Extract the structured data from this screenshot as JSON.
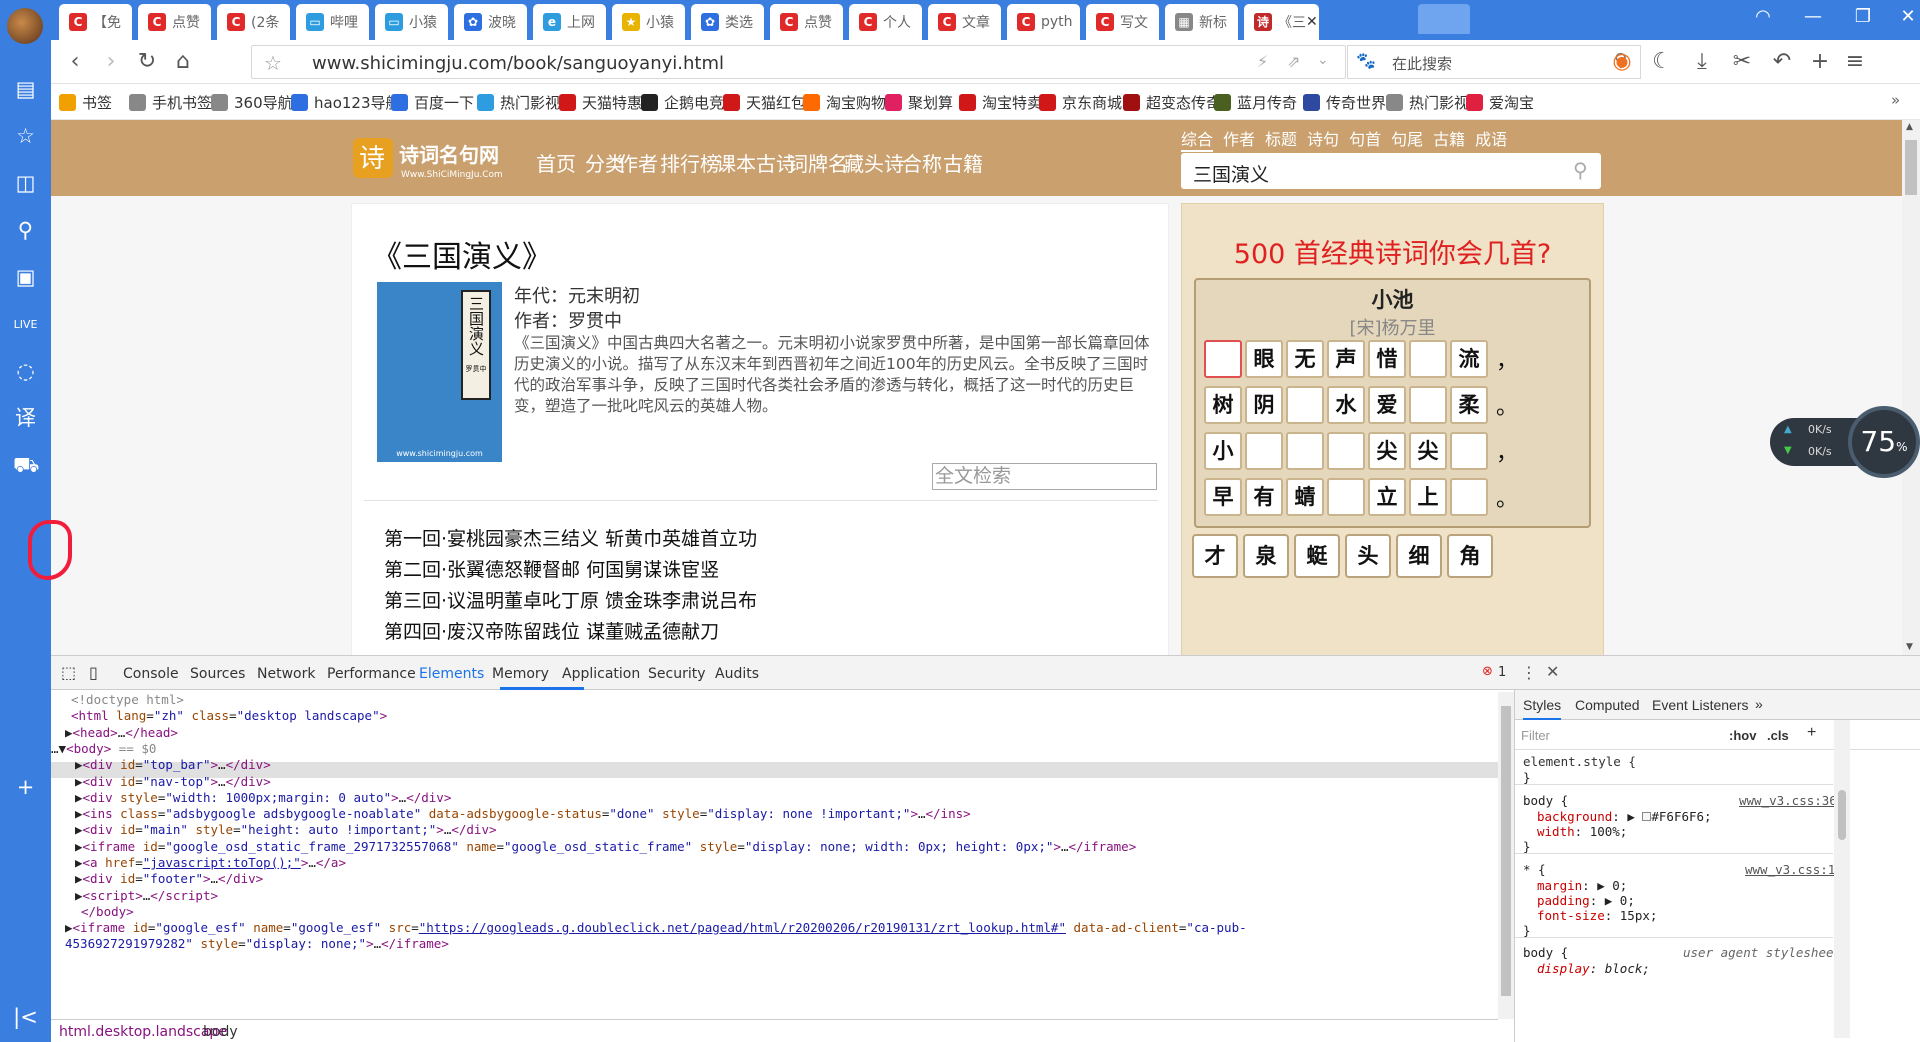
{
  "tabs": [
    {
      "label": "【免",
      "icon": "C",
      "color": "#e02a2a"
    },
    {
      "label": "点赞",
      "icon": "C",
      "color": "#e02a2a"
    },
    {
      "label": "(2条",
      "icon": "C",
      "color": "#e02a2a"
    },
    {
      "label": "哔哩",
      "icon": "tv",
      "color": "#2d9de0"
    },
    {
      "label": "小猿",
      "icon": "tv",
      "color": "#2d9de0"
    },
    {
      "label": "波晓",
      "icon": "paw",
      "color": "#2d6fe0"
    },
    {
      "label": "上网",
      "icon": "e",
      "color": "#2d9de0"
    },
    {
      "label": "小猿",
      "icon": "★",
      "color": "#e8b400"
    },
    {
      "label": "类选",
      "icon": "paw",
      "color": "#2d6fe0"
    },
    {
      "label": "点赞",
      "icon": "C",
      "color": "#e02a2a"
    },
    {
      "label": "个人",
      "icon": "C",
      "color": "#e02a2a"
    },
    {
      "label": "文章",
      "icon": "C",
      "color": "#e02a2a"
    },
    {
      "label": "pyth",
      "icon": "C",
      "color": "#e02a2a"
    },
    {
      "label": "写文",
      "icon": "C",
      "color": "#e02a2a"
    },
    {
      "label": "新标",
      "icon": "grid",
      "color": "#888"
    },
    {
      "label": "《三",
      "icon": "诗",
      "color": "#c02a2a"
    }
  ],
  "url": "www.shicimingju.com/book/sanguoyanyi.html",
  "search_placeholder": "在此搜索",
  "bookmarks": [
    {
      "label": "书签",
      "color": "#f0a000"
    },
    {
      "label": "手机书签",
      "color": "#888"
    },
    {
      "label": "360导航",
      "color": "#888"
    },
    {
      "label": "hao123导航",
      "color": "#2d6fe0"
    },
    {
      "label": "百度一下",
      "color": "#2d6fe0"
    },
    {
      "label": "热门影视",
      "color": "#2d9de0"
    },
    {
      "label": "天猫特惠",
      "color": "#d01818"
    },
    {
      "label": "企鹅电竞",
      "color": "#222"
    },
    {
      "label": "天猫红包",
      "color": "#d01818"
    },
    {
      "label": "淘宝购物",
      "color": "#ff6a00"
    },
    {
      "label": "聚划算",
      "color": "#e02060"
    },
    {
      "label": "淘宝特卖",
      "color": "#d01818"
    },
    {
      "label": "京东商城",
      "color": "#d01818"
    },
    {
      "label": "超变态传奇",
      "color": "#a01010"
    },
    {
      "label": "蓝月传奇",
      "color": "#4a6020"
    },
    {
      "label": "传奇世界",
      "color": "#2d4aa0"
    },
    {
      "label": "热门影视",
      "color": "#888"
    },
    {
      "label": "爱淘宝",
      "color": "#e02040"
    }
  ],
  "site": {
    "nav": [
      "首页",
      "分类",
      "作者",
      "排行榜",
      "课本古诗",
      "词牌名",
      "藏头诗",
      "合称",
      "古籍"
    ],
    "search_tabs": [
      "综合",
      "作者",
      "标题",
      "诗句",
      "句首",
      "句尾",
      "古籍",
      "成语"
    ],
    "search_value": "三国演义"
  },
  "book": {
    "title": "《三国演义》",
    "cover_label": "三国演义",
    "cover_author": "罗贯中",
    "cover_site": "www.shicimingju.com",
    "era": "年代：元末明初",
    "author": "作者：罗贯中",
    "desc": "《三国演义》中国古典四大名著之一。元末明初小说家罗贯中所著，是中国第一部长篇章回体历史演义的小说。描写了从东汉末年到西晋初年之间近100年的历史风云。全书反映了三国时代的政治军事斗争，反映了三国时代各类社会矛盾的渗透与转化，概括了这一时代的历史巨变，塑造了一批叱咤风云的英雄人物。",
    "fulltext_placeholder": "全文检索",
    "chapters": [
      "第一回·宴桃园豪杰三结义 斩黄巾英雄首立功",
      "第二回·张翼德怒鞭督邮 何国舅谋诛宦竖",
      "第三回·议温明董卓叱丁原 馈金珠李肃说吕布",
      "第四回·废汉帝陈留践位 谋董贼孟德献刀"
    ]
  },
  "poem_game": {
    "title": "500 首经典诗词你会几首?",
    "poem": "小池",
    "author": "[宋]杨万里",
    "rows": [
      [
        "",
        "眼",
        "无",
        "声",
        "惜",
        "",
        "流"
      ],
      [
        "树",
        "阴",
        "",
        "水",
        "爱",
        "",
        "柔"
      ],
      [
        "小",
        "",
        "",
        "",
        "尖",
        "尖",
        ""
      ],
      [
        "早",
        "有",
        "蜻",
        "",
        "立",
        "上",
        ""
      ]
    ],
    "punct": [
      "，",
      "。",
      "，",
      "。"
    ],
    "options": [
      "才",
      "泉",
      "蜓",
      "头",
      "细",
      "角"
    ]
  },
  "speed": {
    "up": "0K/s",
    "down": "0K/s",
    "percent": "75",
    "unit": "%"
  },
  "devtools": {
    "tabs": [
      "Console",
      "Sources",
      "Network",
      "Performance",
      "Elements",
      "Memory",
      "Application",
      "Security",
      "Audits"
    ],
    "active": "Elements",
    "errors": "1",
    "breadcrumbs": [
      "html.desktop.landscape",
      "body"
    ],
    "style_tabs": [
      "Styles",
      "Computed",
      "Event Listeners",
      "»"
    ],
    "filter_placeholder": "Filter",
    "hov": ":hov",
    "cls": ".cls"
  }
}
